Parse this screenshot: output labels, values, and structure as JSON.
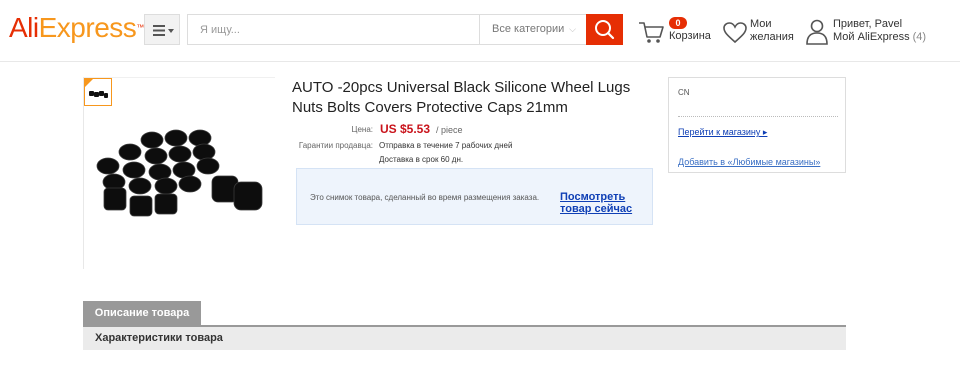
{
  "header": {
    "logo_part1": "Ali",
    "logo_part2": "Express",
    "logo_tm": "™",
    "search": {
      "placeholder": "Я ищу..."
    },
    "category_select": "Все категории",
    "cart": {
      "count": "0",
      "label": "Корзина"
    },
    "wishlist": {
      "line1": "Мои",
      "line2": "желания"
    },
    "account": {
      "line1": "Привет, Pavel",
      "line2": "Мой AliExpress",
      "count": "(4)"
    }
  },
  "product": {
    "title": "AUTO -20pcs Universal Black Silicone Wheel Lugs Nuts Bolts Covers Protective Caps 21mm",
    "price_label": "Цена:",
    "price": "US $5.53",
    "price_unit": "/ piece",
    "guarantee_label": "Гарантии продавца:",
    "shipping_line1": "Отправка в течение 7 рабочих дней",
    "shipping_line2": "Доставка в срок 60 дн.",
    "snapshot_text": "Это снимок товара, сделанный во время размещения заказа.",
    "snapshot_link": "Посмотреть товар сейчас"
  },
  "store": {
    "country": "CN",
    "go_to_store": "Перейти к магазину ▸",
    "add_favorite": "Добавить в «Любимые магазины»"
  },
  "tabs": {
    "description": "Описание товара",
    "specs": "Характеристики товара"
  },
  "colors": {
    "brand_red": "#e62e04",
    "brand_orange": "#f7971d",
    "price_red": "#c9131b",
    "link_blue": "#0f3fb5"
  }
}
